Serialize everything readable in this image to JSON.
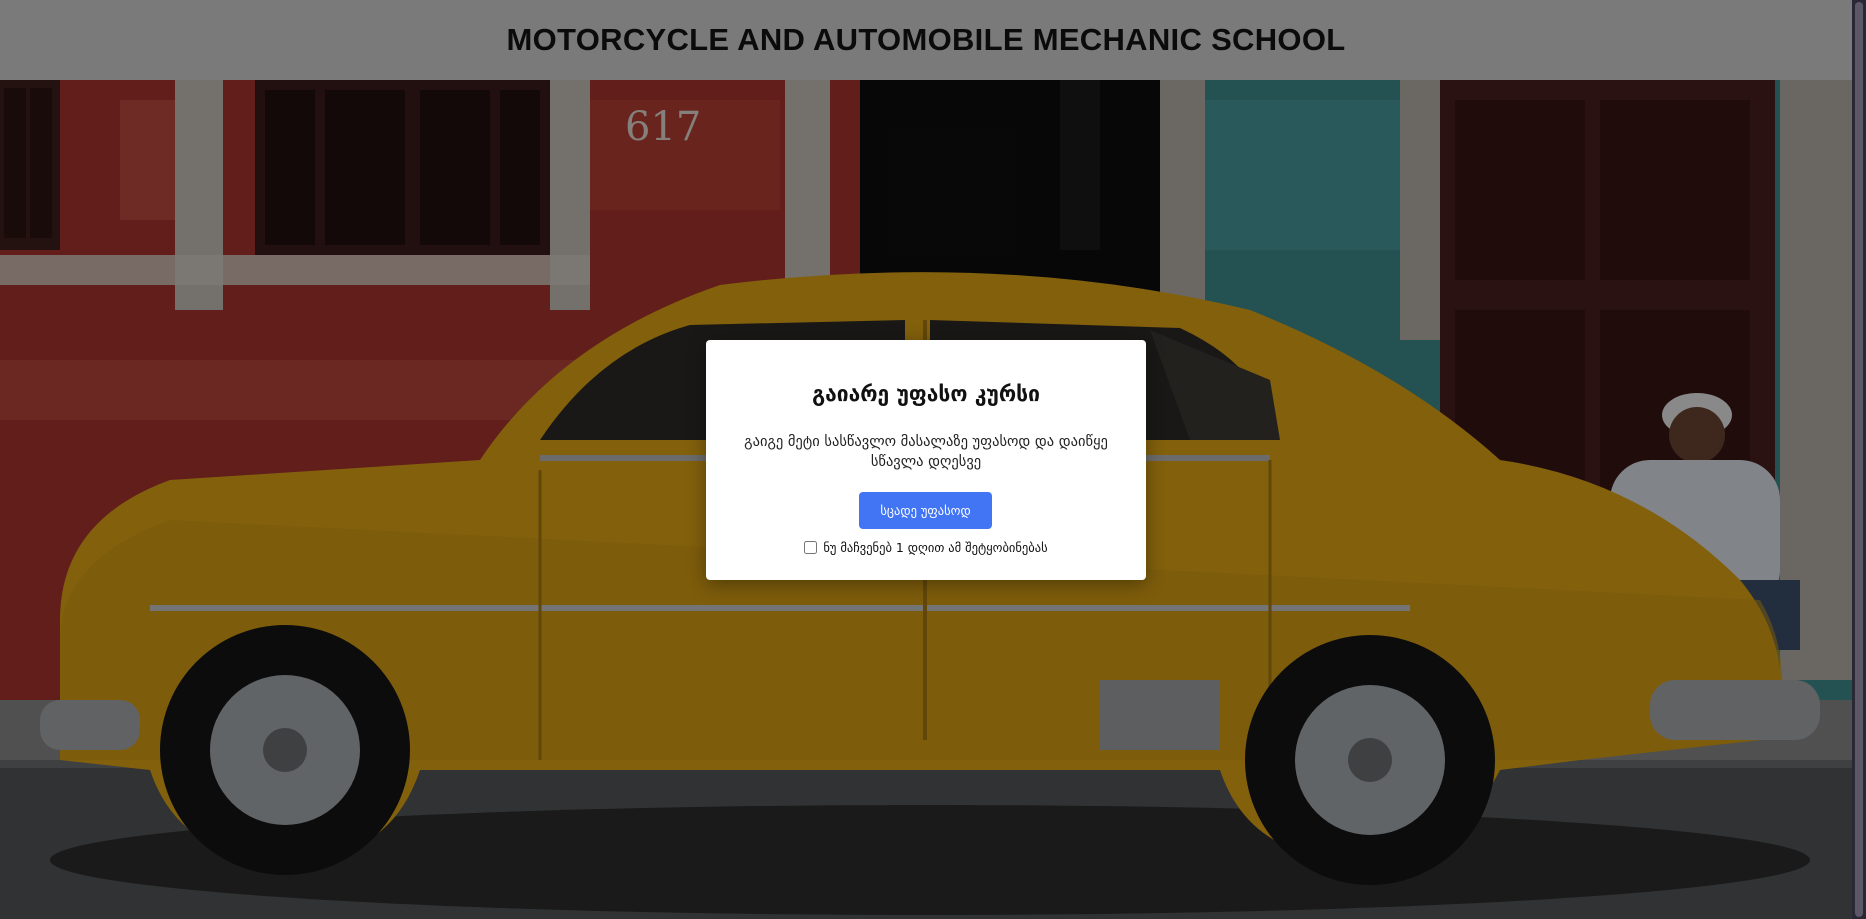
{
  "header": {
    "title": "MOTORCYCLE AND AUTOMOBILE MECHANIC SCHOOL"
  },
  "hero": {
    "building_number": "617",
    "image_alt": "yellow-vintage-car-photo"
  },
  "modal": {
    "title": "გაიარე უფასო კურსი",
    "description": "გაიგე მეტი სასწავლო მასალაზე უფასოდ და დაიწყე სწავლა დღესვე",
    "cta_label": "სცადე უფასოდ",
    "dismiss_label": "ნუ მაჩვენებ 1 დღით ამ შეტყობინებას",
    "dismiss_checked": false
  },
  "colors": {
    "header_bg": "#7a7a7a",
    "cta_bg": "#4275f4",
    "modal_bg": "#ffffff"
  }
}
